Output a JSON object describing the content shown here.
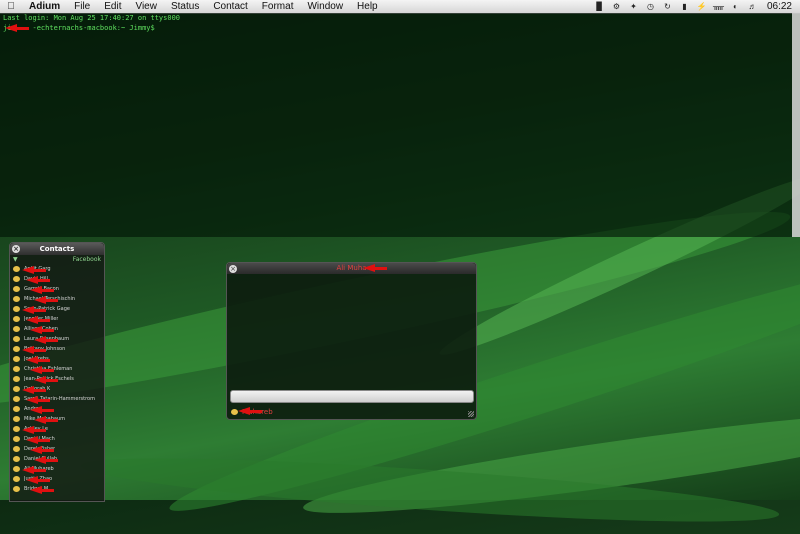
{
  "menubar": {
    "apple": "",
    "items": [
      "Adium",
      "File",
      "Edit",
      "View",
      "Status",
      "Contact",
      "Format",
      "Window",
      "Help"
    ],
    "status_icons": [
      "terminal-icon",
      "gear-icon",
      "wand-icon",
      "time-machine-icon",
      "sync-icon",
      "lock-icon",
      "bolt-icon",
      "bluetooth-icon",
      "wifi-icon",
      "volume-icon"
    ],
    "clock": "06:22"
  },
  "terminal": {
    "lines": [
      "Last login: Mon Aug 25 17:40:27 on ttys000",
      "ji     -echternachs-macbook:~ Jimmy$"
    ]
  },
  "contacts": {
    "title": "Contacts",
    "group": "Facebook",
    "items": [
      "Ankit Garg",
      "David Hill",
      "Garrett Bacon",
      "Michael Terschischin",
      "Sean-Patrick Gage",
      "Jennifer Miller",
      "Allison Cohen",
      "Laura Rosenbaum",
      "Brittany Johnson",
      "Joel Krebs",
      "Christina Eshleman",
      "Jean-Patrick Eschels",
      "Deborah K",
      "Sarah Tatarin-Hammerstrom",
      "Andrea",
      "Mike Mahabaum",
      "Ashley Le",
      "Daniel Mach",
      "Derek Fisher",
      "Daniel Cullah",
      "Ali Muhareb",
      "Justin Zhao",
      "Bridget M"
    ]
  },
  "chat": {
    "title": "Ali Muha",
    "footer_name": "Muhareb"
  },
  "colors": {
    "terminal_text": "#5fe05f",
    "arrow": "#e01010",
    "group": "#8fd58f"
  }
}
